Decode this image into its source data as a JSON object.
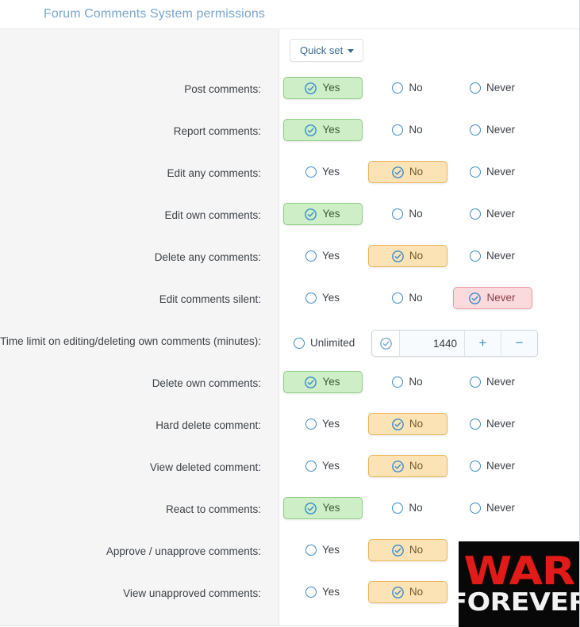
{
  "header": {
    "title": "Forum Comments System permissions"
  },
  "toolbar": {
    "quick_set_label": "Quick set",
    "caret_icon": "chevron-down-icon"
  },
  "colors": {
    "title": "#7ba7cc",
    "yes_selected_bg": "#cdeec7",
    "yes_selected_border": "#8fcf85",
    "no_selected_bg": "#fbe3b6",
    "no_selected_border": "#e9b85a",
    "never_selected_bg": "#fadadd",
    "never_selected_border": "#ee9aa3",
    "radio_ring": "#3b8cca",
    "label_column_bg": "#f5f5f5",
    "war_red": "#e01b18",
    "war_black": "#080808"
  },
  "options": {
    "yes": "Yes",
    "no": "No",
    "never": "Never",
    "unlimited": "Unlimited"
  },
  "rows": [
    {
      "label": "Post comments:",
      "selected": "yes"
    },
    {
      "label": "Report comments:",
      "selected": "yes"
    },
    {
      "label": "Edit any comments:",
      "selected": "no"
    },
    {
      "label": "Edit own comments:",
      "selected": "yes"
    },
    {
      "label": "Delete any comments:",
      "selected": "no"
    },
    {
      "label": "Edit comments silent:",
      "selected": "never"
    }
  ],
  "time_limit_row": {
    "label": "Time limit on editing/deleting own comments (minutes):",
    "unlimited_label": "Unlimited",
    "unlimited_selected": false,
    "value_selected": true,
    "value": "1440",
    "increment_label": "+",
    "decrement_label": "−"
  },
  "rows_after": [
    {
      "label": "Delete own comments:",
      "selected": "yes"
    },
    {
      "label": "Hard delete comment:",
      "selected": "no"
    },
    {
      "label": "View deleted comment:",
      "selected": "no"
    },
    {
      "label": "React to comments:",
      "selected": "yes"
    },
    {
      "label": "Approve / unapprove comments:",
      "selected": "no"
    },
    {
      "label": "View unapproved comments:",
      "selected": "no"
    }
  ],
  "overlay_banner": {
    "line1": "WAR",
    "line2": "FOREVER"
  }
}
